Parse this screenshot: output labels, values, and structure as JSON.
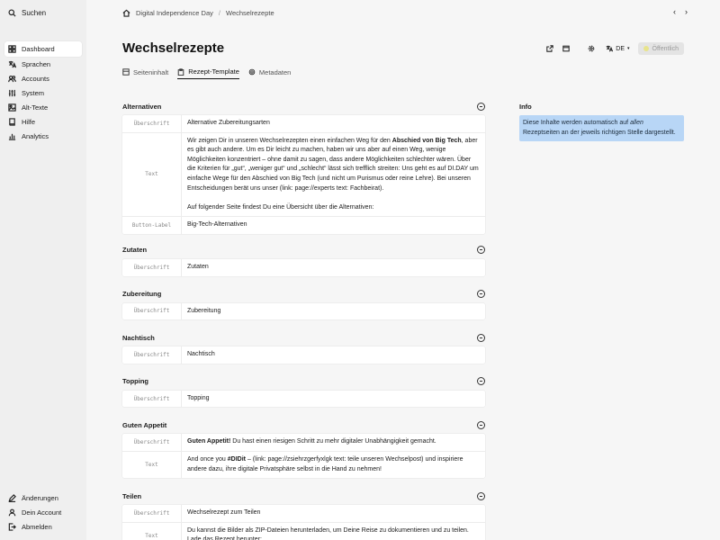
{
  "sidebar": {
    "search_label": "Suchen",
    "items": [
      {
        "label": "Dashboard",
        "icon": "grid-icon",
        "active": true
      },
      {
        "label": "Sprachen",
        "icon": "translate-icon"
      },
      {
        "label": "Accounts",
        "icon": "users-icon"
      },
      {
        "label": "System",
        "icon": "sliders-icon"
      },
      {
        "label": "Alt-Texte",
        "icon": "image-icon"
      },
      {
        "label": "Hilfe",
        "icon": "book-icon"
      },
      {
        "label": "Analytics",
        "icon": "chart-icon"
      }
    ],
    "bottom_items": [
      {
        "label": "Änderungen",
        "icon": "pen-icon"
      },
      {
        "label": "Dein Account",
        "icon": "account-icon"
      },
      {
        "label": "Abmelden",
        "icon": "logout-icon"
      }
    ]
  },
  "breadcrumb": {
    "site": "Digital Independence Day",
    "page": "Wechselrezepte"
  },
  "page": {
    "title": "Wechselrezepte",
    "language": "DE",
    "status": "Öffentlich"
  },
  "tabs": [
    {
      "label": "Seiteninhalt"
    },
    {
      "label": "Rezept-Template",
      "active": true
    },
    {
      "label": "Metadaten"
    }
  ],
  "sections": [
    {
      "title": "Alternativen",
      "rows": [
        {
          "label": "Überschrift",
          "value": "Alternative Zubereitungsarten"
        },
        {
          "label": "Text",
          "paragraphs": [
            "Wir zeigen Dir in unseren Wechselrezepten einen einfachen Weg für den <b>Abschied von Big Tech</b>, aber es gibt auch andere. Um es Dir leicht zu machen, haben wir uns aber auf einen Weg, wenige Möglichkeiten konzentriert – ohne damit zu sagen, dass andere Möglichkeiten schlechter wären. Über die Kriterien für „gut“, „weniger gut“ und „schlecht“ lässt sich trefflich streiten: Uns geht es auf DI.DAY um einfache Wege für den Abschied von Big Tech (und nicht um Purismus oder reine Lehre). Bei unseren Entscheidungen berät uns unser (link: page://experts text: Fachbeirat).",
            "Auf folgender Seite findest Du eine Übersicht über die Alternativen:"
          ]
        },
        {
          "label": "Button-Label",
          "value": "Big-Tech-Alternativen"
        }
      ]
    },
    {
      "title": "Zutaten",
      "rows": [
        {
          "label": "Überschrift",
          "value": "Zutaten"
        }
      ]
    },
    {
      "title": "Zubereitung",
      "rows": [
        {
          "label": "Überschrift",
          "value": "Zubereitung"
        }
      ]
    },
    {
      "title": "Nachtisch",
      "rows": [
        {
          "label": "Überschrift",
          "value": "Nachtisch"
        }
      ]
    },
    {
      "title": "Topping",
      "rows": [
        {
          "label": "Überschrift",
          "value": "Topping"
        }
      ]
    },
    {
      "title": "Guten Appetit",
      "rows": [
        {
          "label": "Überschrift",
          "value": "<b>Guten Appetit!</b> Du hast einen riesigen Schritt zu mehr digitaler Unabhängigkeit gemacht."
        },
        {
          "label": "Text",
          "value": "And once you <b>#DIDit</b> – (link: page://zsiehrzgerfyxlgk text: teile unseren Wechselpost) und inspiriere andere dazu, ihre digitale Privatsphäre selbst in die Hand zu nehmen!"
        }
      ]
    },
    {
      "title": "Teilen",
      "rows": [
        {
          "label": "Überschrift",
          "value": "Wechselrezept zum Teilen"
        },
        {
          "label": "Text",
          "value": "Du kannst die Bilder als ZIP-Dateien herunterladen, um Deine Reise zu dokumentieren und zu teilen. Lade das Rezept herunter:"
        }
      ]
    }
  ],
  "info": {
    "title": "Info",
    "text_before": "Diese Inhalte werden automatisch auf ",
    "text_emph": "allen",
    "text_after": " Rezeptseiten an der jeweils richtigen Stelle dargestellt."
  }
}
